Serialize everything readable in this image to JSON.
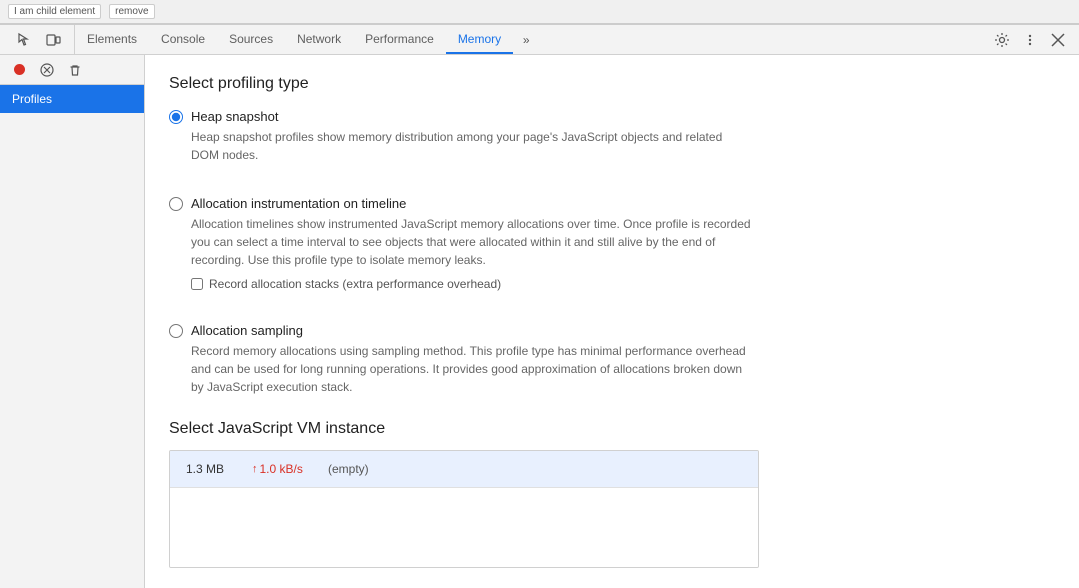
{
  "webpage": {
    "tag_text": "I am child element",
    "remove_label": "remove"
  },
  "devtools": {
    "toolbar": {
      "inspect_icon": "⬡",
      "device_icon": "▭"
    },
    "tabs": [
      {
        "id": "elements",
        "label": "Elements",
        "active": false
      },
      {
        "id": "console",
        "label": "Console",
        "active": false
      },
      {
        "id": "sources",
        "label": "Sources",
        "active": false
      },
      {
        "id": "network",
        "label": "Network",
        "active": false
      },
      {
        "id": "performance",
        "label": "Performance",
        "active": false
      },
      {
        "id": "memory",
        "label": "Memory",
        "active": true
      }
    ],
    "tabs_more_label": "»",
    "settings_icon": "⚙",
    "more_icon": "⋮",
    "close_icon": "✕"
  },
  "sidebar": {
    "record_icon": "●",
    "stop_icon": "⊘",
    "clear_icon": "🗑",
    "items": [
      {
        "id": "profiles",
        "label": "Profiles",
        "active": true
      }
    ]
  },
  "main": {
    "select_profiling_title": "Select profiling type",
    "options": [
      {
        "id": "heap-snapshot",
        "label": "Heap snapshot",
        "description": "Heap snapshot profiles show memory distribution among your page's JavaScript objects and related DOM nodes.",
        "checked": true
      },
      {
        "id": "allocation-instrumentation",
        "label": "Allocation instrumentation on timeline",
        "description": "Allocation timelines show instrumented JavaScript memory allocations over time. Once profile is recorded you can select a time interval to see objects that were allocated within it and still alive by the end of recording. Use this profile type to isolate memory leaks.",
        "checked": false,
        "checkbox": {
          "label": "Record allocation stacks (extra performance overhead)",
          "checked": false
        }
      },
      {
        "id": "allocation-sampling",
        "label": "Allocation sampling",
        "description": "Record memory allocations using sampling method. This profile type has minimal performance overhead and can be used for long running operations. It provides good approximation of allocations broken down by JavaScript execution stack.",
        "checked": false
      }
    ],
    "js_vm_title": "Select JavaScript VM instance",
    "vm_instance": {
      "size": "1.3 MB",
      "rate": "1.0 kB/s",
      "name": "(empty)"
    }
  }
}
